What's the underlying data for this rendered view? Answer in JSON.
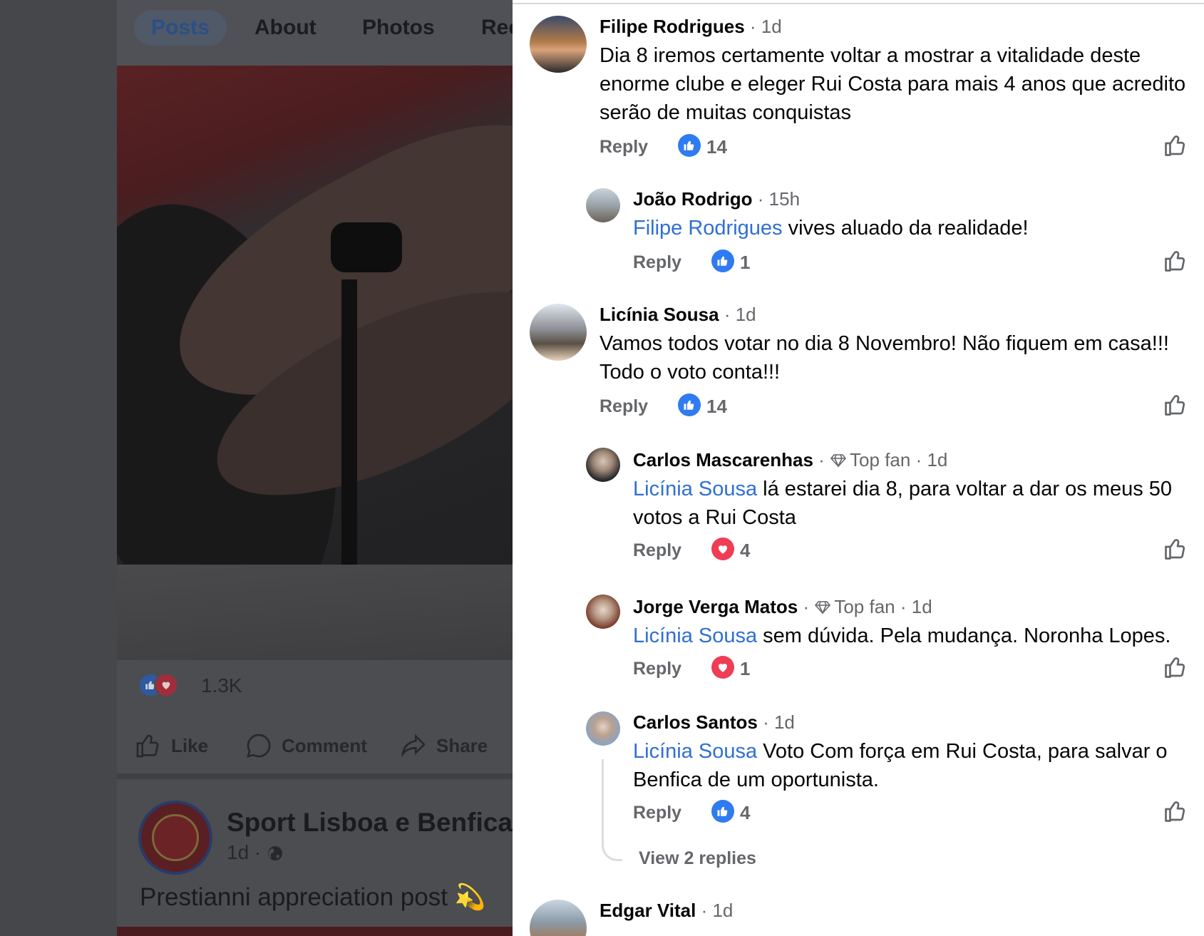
{
  "background_page": {
    "tabs": [
      "Posts",
      "About",
      "Photos",
      "Ree"
    ],
    "reactions": {
      "count": "1.3K",
      "icons": [
        "like-icon",
        "love-icon"
      ]
    },
    "actions": {
      "like": "Like",
      "comment": "Comment",
      "share": "Share"
    },
    "post2": {
      "page_name": "Sport Lisboa e Benfica",
      "meta": "1d ·",
      "text": "Prestianni appreciation post",
      "emoji": "💫"
    }
  },
  "comments": [
    {
      "name": "Filipe Rodrigues",
      "meta": "· 1d",
      "text": "Dia 8 iremos certamente voltar a mostrar a vitalidade deste enorme clube e eleger Rui Costa para mais 4 anos que acredito serão de muitas conquistas",
      "reply": "Reply",
      "reaction": "like",
      "count": "14"
    },
    {
      "name": "João Rodrigo",
      "meta": "· 15h",
      "mention": "Filipe Rodrigues",
      "text": " vives aluado da realidade!",
      "reply": "Reply",
      "reaction": "like",
      "count": "1"
    },
    {
      "name": "Licínia Sousa",
      "meta": "· 1d",
      "text": "Vamos todos votar no dia 8 Novembro! Não fiquem em casa!!! Todo o voto conta!!!",
      "reply": "Reply",
      "reaction": "like",
      "count": "14"
    },
    {
      "name": "Carlos Mascarenhas",
      "sep": "·",
      "badge": "Top fan",
      "meta": "· 1d",
      "mention": "Licínia Sousa",
      "text": " lá estarei dia 8, para voltar a dar os meus 50 votos a Rui Costa",
      "reply": "Reply",
      "reaction": "love",
      "count": "4"
    },
    {
      "name": "Jorge Verga Matos",
      "sep": "·",
      "badge": "Top fan",
      "meta": "· 1d",
      "mention": "Licínia Sousa",
      "text": " sem dúvida. Pela mudança. Noronha Lopes.",
      "reply": "Reply",
      "reaction": "love",
      "count": "1"
    },
    {
      "name": "Carlos Santos",
      "meta": "· 1d",
      "mention": "Licínia Sousa",
      "text": " Voto Com força em Rui Costa, para salvar o Benfica de um oportunista.",
      "reply": "Reply",
      "reaction": "like",
      "count": "4"
    },
    {
      "name": "Edgar Vital",
      "meta": "· 1d"
    }
  ],
  "view_replies": "View 2 replies",
  "colors": {
    "mention": "#2f6fd4",
    "like": "#2f7bf2",
    "love": "#ef3d55",
    "secondary_text": "#65676b"
  }
}
